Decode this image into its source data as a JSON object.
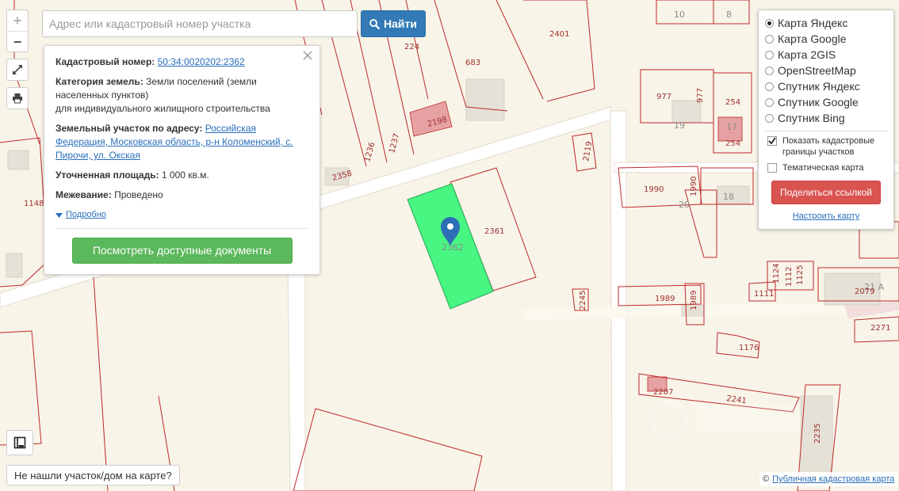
{
  "search": {
    "placeholder": "Адрес или кадастровый номер участка",
    "button_label": "Найти"
  },
  "zoom": {
    "in_label": "+",
    "out_label": "−"
  },
  "info": {
    "cadastral_label": "Кадастровый номер:",
    "cadastral_value": "50:34:0020202:2362",
    "category_label": "Категория земель:",
    "category_value": "Земли поселений (земли населенных пунктов)",
    "use_value": "для индивидуального жилищного строительства",
    "address_label": "Земельный участок по адресу:",
    "address_value": "Российская Федерация, Московская область, р-н Коломенский, с. Пирочи, ул. Окская",
    "area_label": "Уточненная площадь:",
    "area_value": "1 000 кв.м.",
    "survey_label": "Межевание:",
    "survey_value": "Проведено",
    "more_label": "Подробно",
    "docs_button": "Посмотреть доступные документы"
  },
  "layers": {
    "options": [
      {
        "label": "Карта Яндекс",
        "selected": true
      },
      {
        "label": "Карта Google",
        "selected": false
      },
      {
        "label": "Карта 2GIS",
        "selected": false
      },
      {
        "label": "OpenStreetMap",
        "selected": false
      },
      {
        "label": "Спутник Яндекс",
        "selected": false
      },
      {
        "label": "Спутник Google",
        "selected": false
      },
      {
        "label": "Спутник Bing",
        "selected": false
      }
    ],
    "show_boundaries": {
      "label": "Показать кадастровые границы участков",
      "checked": true
    },
    "thematic": {
      "label": "Тематическая карта",
      "checked": false
    },
    "share_button": "Поделиться ссылкой",
    "configure_link": "Настроить карту"
  },
  "not_found_button": "Не нашли участок/дом на карте?",
  "attribution": {
    "symbol": "©",
    "link": "Публичная кадастровая карта"
  },
  "map": {
    "labels": {
      "p10": "10",
      "p8": "8",
      "p2401": "2401",
      "p224": "224",
      "p683": "683",
      "p977a": "977",
      "p977b": "977",
      "p254a": "254",
      "p254b": "254",
      "p17": "17",
      "p19": "19",
      "p2198": "2198",
      "p1236": "1236",
      "p1237": "1237",
      "p2358": "2358",
      "p1148": "1148",
      "p2119": "2119",
      "p1990a": "1990",
      "p1990b": "1990",
      "p20": "20",
      "p18": "18",
      "p2362": "2362",
      "p2361": "2361",
      "p2245": "2245",
      "p1989a": "1989",
      "p1989b": "1989",
      "p1124": "1124",
      "p1112": "1112",
      "p1125": "1125",
      "p1111": "1111",
      "p21a": "21 А",
      "p2079": "2079",
      "p2271": "2271",
      "p1176": "1176",
      "p2207": "2207",
      "p2241": "2241",
      "p2235": "2235"
    },
    "colors": {
      "parcel_border": "#c0292b",
      "selected_fill": "#3ef57c",
      "marker": "#2d6fb6"
    }
  }
}
